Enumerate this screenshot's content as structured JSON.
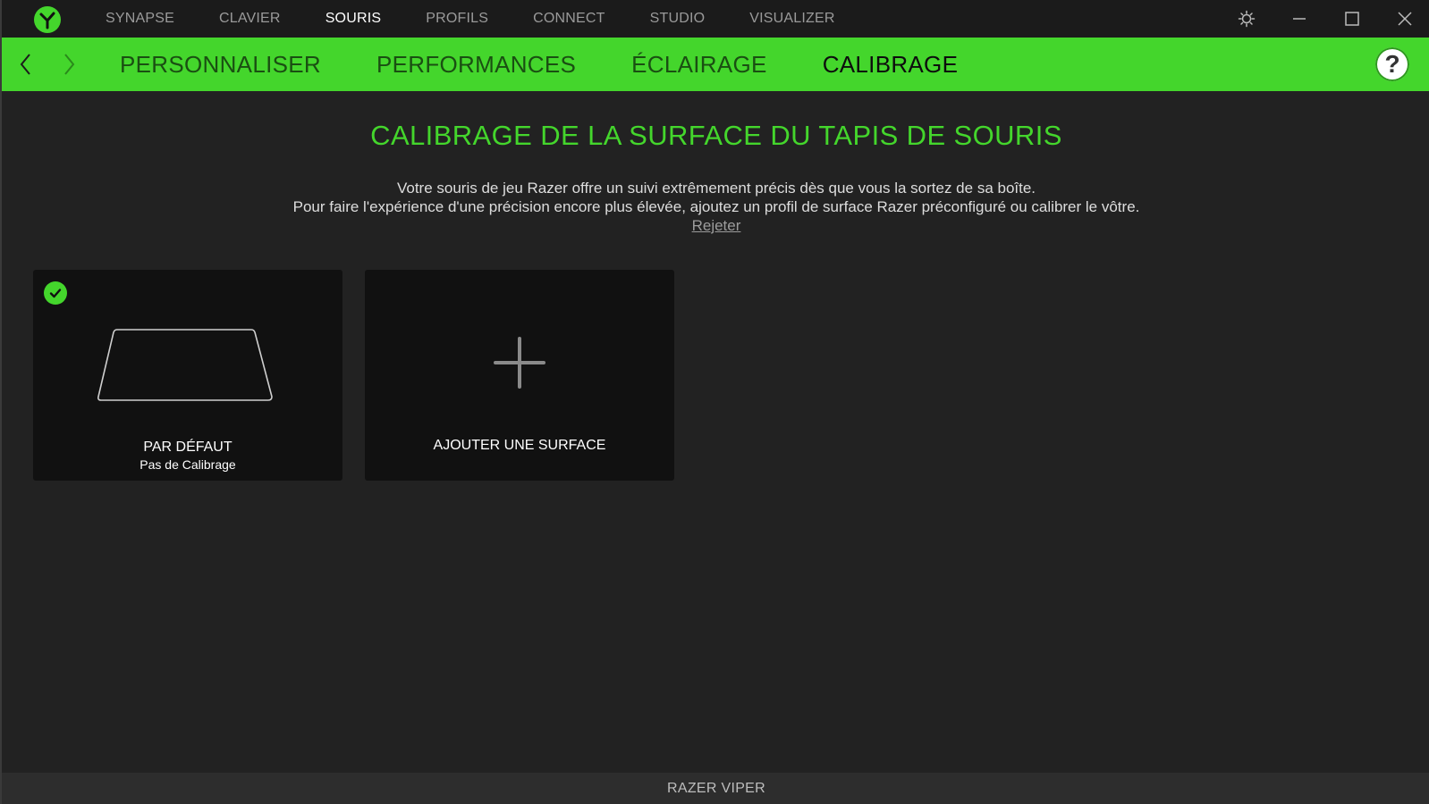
{
  "main_nav": {
    "tabs": [
      {
        "label": "SYNAPSE"
      },
      {
        "label": "CLAVIER"
      },
      {
        "label": "SOURIS"
      },
      {
        "label": "PROFILS"
      },
      {
        "label": "CONNECT"
      },
      {
        "label": "STUDIO"
      },
      {
        "label": "VISUALIZER"
      }
    ],
    "active": "SOURIS"
  },
  "window_controls": [
    "settings-icon",
    "minimize-icon",
    "maximize-icon",
    "close-icon"
  ],
  "sub_nav": {
    "tabs": [
      {
        "label": "PERSONNALISER"
      },
      {
        "label": "PERFORMANCES"
      },
      {
        "label": "ÉCLAIRAGE"
      },
      {
        "label": "CALIBRAGE"
      }
    ],
    "active": "CALIBRAGE",
    "help_label": "?"
  },
  "content": {
    "heading": "CALIBRAGE DE LA SURFACE DU TAPIS DE SOURIS",
    "description_line1": "Votre souris de jeu Razer offre un suivi extrêmement précis dès que vous la sortez de sa boîte.",
    "description_line2": "Pour faire l'expérience d'une précision encore plus élevée, ajoutez un profil de surface Razer préconfiguré ou calibrer le vôtre.",
    "reject_label": "Rejeter"
  },
  "cards": [
    {
      "title": "PAR DÉFAUT",
      "subtitle": "Pas de Calibrage",
      "selected": true
    },
    {
      "title": "AJOUTER UNE SURFACE"
    }
  ],
  "footer": {
    "device": "RAZER VIPER"
  },
  "colors": {
    "accent": "#44d62c",
    "background": "#222222",
    "card": "#111111"
  }
}
